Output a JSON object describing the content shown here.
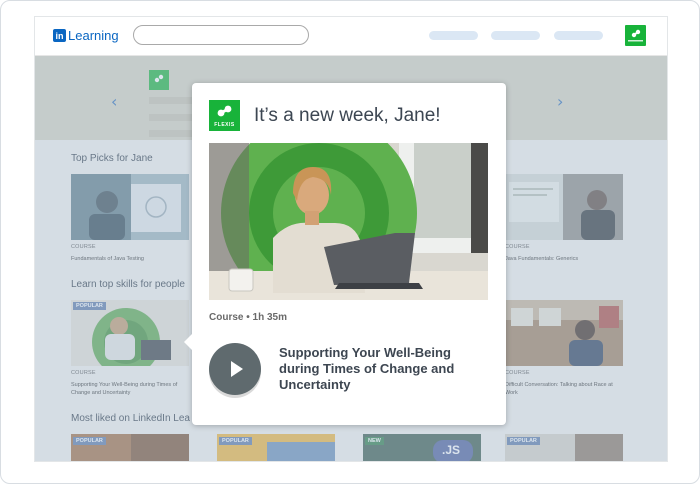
{
  "nav": {
    "brand_logo": "in",
    "brand_name": "Learning",
    "search_placeholder": ""
  },
  "sections": [
    {
      "title": "Top Picks for Jane",
      "cards": [
        {
          "type_label": "COURSE",
          "name": "Fundamentals of Java Testing"
        },
        {
          "type_label": "COURSE",
          "name": "Java Fundamentals: Generics"
        }
      ]
    },
    {
      "title": "Learn top skills for people",
      "cards": [
        {
          "badge": "POPULAR",
          "type_label": "COURSE",
          "name": "Supporting Your Well-Being during Times of Change and Uncertainty"
        },
        {
          "type_label": "COURSE",
          "name": "Difficult Conversation: Talking about Race at Work"
        }
      ]
    },
    {
      "title": "Most liked on LinkedIn Lea",
      "badges": [
        "POPULAR",
        "POPULAR",
        "NEW",
        "POPULAR"
      ],
      "card_text": ".JS"
    }
  ],
  "popup": {
    "logo_text": "FLEXIS",
    "greeting": "It’s a new week, Jane!",
    "meta": "Course • 1h 35m",
    "course_title": "Supporting Your Well-Being during Times of Change and Uncertainty"
  },
  "colors": {
    "brand_blue": "#0a66c2",
    "flexis_green": "#18b33a",
    "badge_blue": "#5b79a8",
    "badge_green": "#2d7d46"
  },
  "icons": [
    "chevron-left-icon",
    "chevron-right-icon",
    "play-icon",
    "flexis-logo-icon"
  ]
}
